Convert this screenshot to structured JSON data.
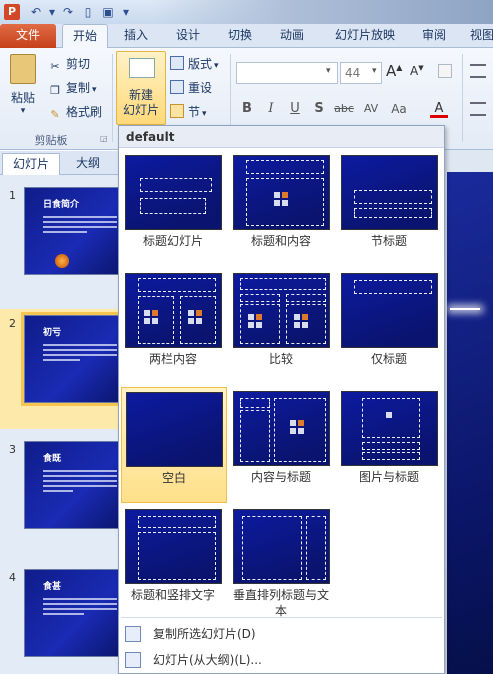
{
  "quick_access": {
    "app_icon": "P",
    "undo_icon": "undo-icon",
    "redo_icon": "redo-icon",
    "new_icon": "new-doc-icon",
    "save_icon": "save-icon"
  },
  "ribbon_tabs": [
    "文件",
    "开始",
    "插入",
    "设计",
    "切换",
    "动画",
    "幻灯片放映",
    "审阅",
    "视图"
  ],
  "clipboard": {
    "paste": "粘贴",
    "cut": "剪切",
    "copy": "复制",
    "format_painter": "格式刷",
    "group": "剪贴板"
  },
  "slides_group": {
    "new_slide_line1": "新建",
    "new_slide_line2": "幻灯片",
    "layout": "版式",
    "reset": "重设",
    "section": "节"
  },
  "font_group": {
    "font_name": "",
    "font_size": "44",
    "grow": "A",
    "shrink": "A",
    "bold": "B",
    "italic": "I",
    "underline": "U",
    "shadow": "S",
    "strikethrough": "abc",
    "spacing": "AV",
    "case": "Aa",
    "color": "A"
  },
  "left_panel": {
    "tab_slides": "幻灯片",
    "tab_outline": "大纲"
  },
  "slides": [
    {
      "number": "1",
      "title": "日食简介"
    },
    {
      "number": "2",
      "title": "初亏"
    },
    {
      "number": "3",
      "title": "食既"
    },
    {
      "number": "4",
      "title": "食甚"
    }
  ],
  "dropdown": {
    "header": "default",
    "layouts": [
      {
        "label": "标题幻灯片"
      },
      {
        "label": "标题和内容"
      },
      {
        "label": "节标题"
      },
      {
        "label": "两栏内容"
      },
      {
        "label": "比较"
      },
      {
        "label": "仅标题"
      },
      {
        "label": "空白"
      },
      {
        "label": "内容与标题"
      },
      {
        "label": "图片与标题"
      },
      {
        "label": "标题和竖排文字"
      },
      {
        "label": "垂直排列标题与文本"
      }
    ],
    "cmd_duplicate": "复制所选幻灯片(D)",
    "cmd_from_outline": "幻灯片(从大纲)(L)..."
  },
  "colors": {
    "accent_file": "#d24726",
    "slide_blue": "#1a2bb4",
    "highlight": "#ffe08a"
  }
}
